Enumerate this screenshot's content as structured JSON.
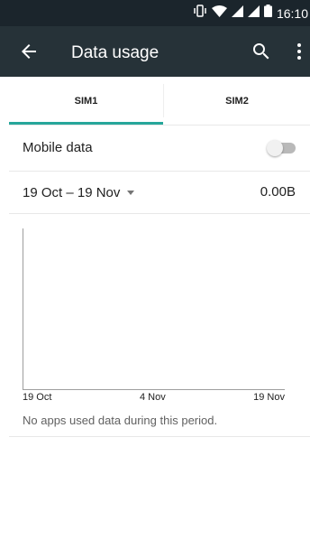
{
  "status_bar": {
    "time": "16:10",
    "icons": [
      "vibrate-icon",
      "wifi-icon",
      "signal-icon",
      "signal-icon-2",
      "battery-icon"
    ]
  },
  "app_bar": {
    "title": "Data usage",
    "back_icon": "arrow-back-icon",
    "search_icon": "search-icon",
    "more_icon": "more-vert-icon"
  },
  "tabs": [
    {
      "label": "SIM1",
      "selected": true
    },
    {
      "label": "SIM2",
      "selected": false
    }
  ],
  "mobile_data": {
    "label": "Mobile data",
    "enabled": false
  },
  "cycle": {
    "range": "19 Oct – 19 Nov",
    "total": "0.00B"
  },
  "chart": {
    "start_label": "19 Oct",
    "mid_label": "4 Nov",
    "end_label": "19 Nov"
  },
  "empty_message": "No apps used data during this period.",
  "colors": {
    "status_bar": "#1b252c",
    "app_bar": "#263238",
    "accent": "#26a69a",
    "text_primary": "#212121",
    "text_secondary": "#616161"
  }
}
